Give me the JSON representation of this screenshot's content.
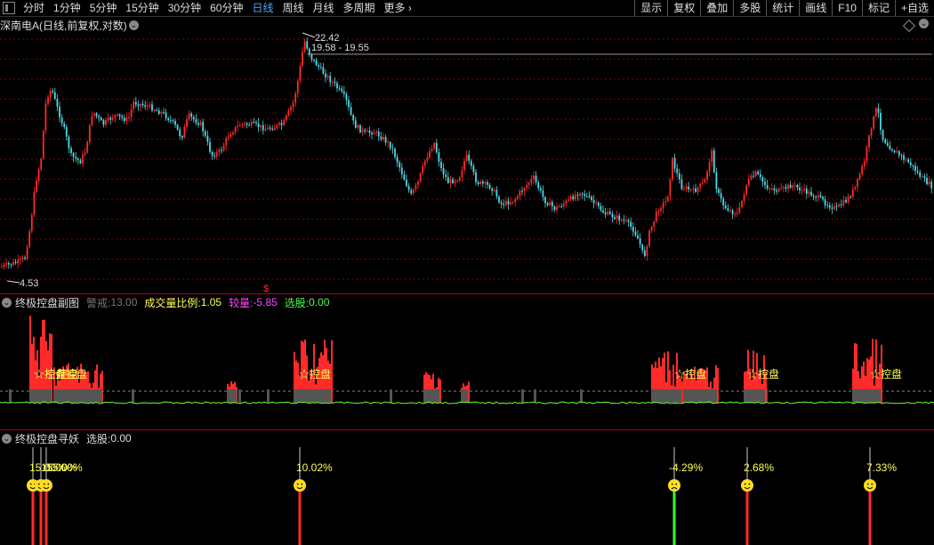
{
  "toolbar": {
    "periods": [
      "分时",
      "1分钟",
      "5分钟",
      "15分钟",
      "30分钟",
      "60分钟",
      "日线",
      "周线",
      "月线",
      "多周期",
      "更多"
    ],
    "active": "日线",
    "more_icon": "chevron-right-icon",
    "right_buttons": [
      "显示",
      "复权",
      "叠加",
      "多股",
      "统计",
      "画线",
      "F10",
      "标记",
      "+自选"
    ]
  },
  "main_panel": {
    "title": "深南电A(日线,前复权,对数)",
    "high_label": "22.42",
    "range_label": "19.58 - 19.55",
    "low_label": "4.53",
    "signal_mark": "$"
  },
  "sub_panel1": {
    "title": "终极控盘副图",
    "warn_label": "警戒:",
    "warn_value": "13.00",
    "ratio_label": "成交量比例:",
    "ratio_value": "1.05",
    "vol_label": "较量:",
    "vol_value": "-5.85",
    "pick_label": "选股:",
    "pick_value": "0.00",
    "control_label": "☆控盘"
  },
  "sub_panel2": {
    "title": "终极控盘寻妖",
    "pick_label": "选股:",
    "pick_value": "0.00",
    "signals": [
      "15.00%",
      "10.02%",
      "-4.29%",
      "2.68%",
      "7.33%"
    ]
  },
  "colors": {
    "up": "#ff2a2a",
    "down": "#4fd8e6",
    "grid": "#7a0010",
    "separator": "#b00020",
    "volume_bar": "#555555",
    "baseline": "#66ff33",
    "smiley": "#ffdd22"
  }
}
